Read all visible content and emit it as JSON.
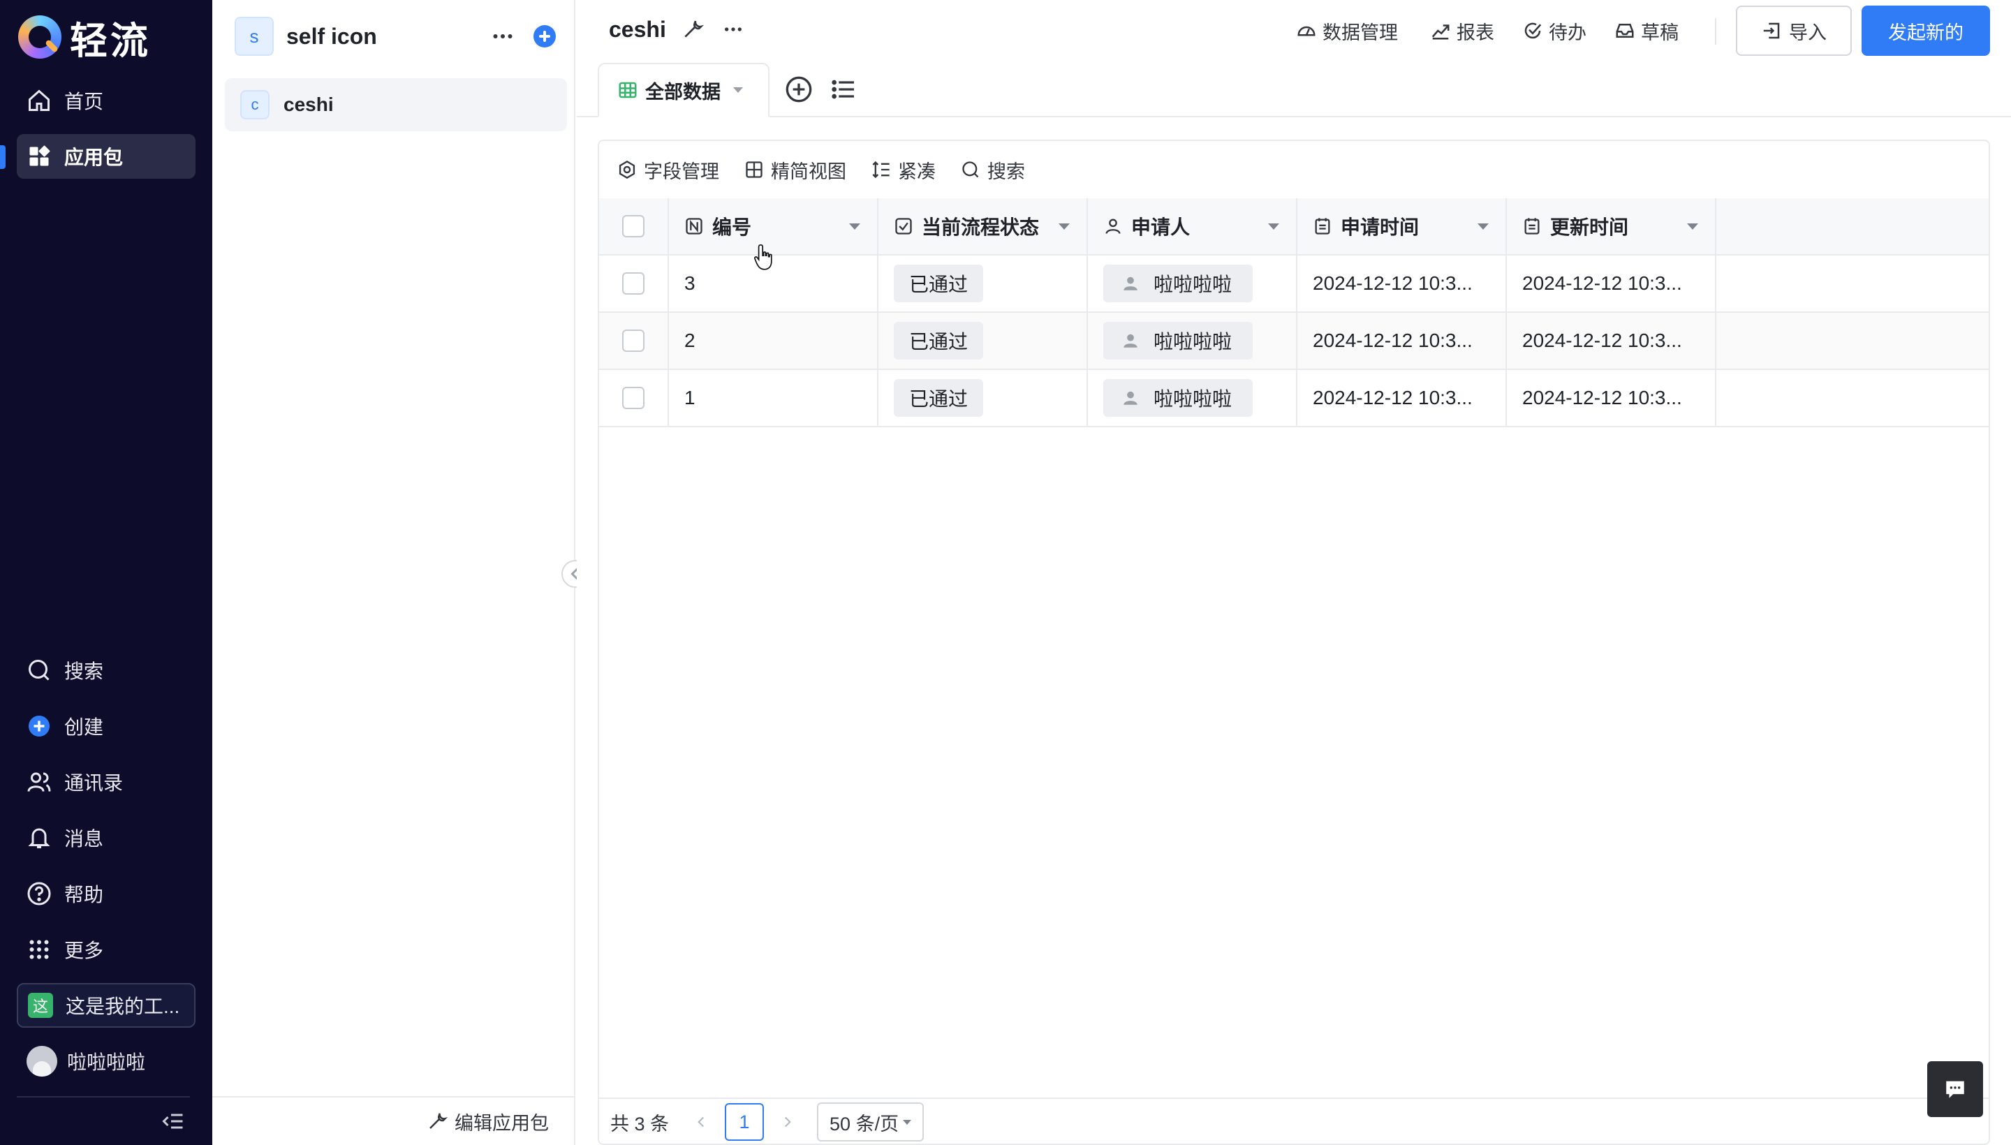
{
  "brand": {
    "name": "轻流"
  },
  "nav": {
    "items": [
      {
        "key": "home",
        "label": "首页",
        "icon": "home-icon"
      },
      {
        "key": "apps",
        "label": "应用包",
        "icon": "grid-apps-icon",
        "active": true
      },
      {
        "key": "search",
        "label": "搜索",
        "icon": "search-icon"
      },
      {
        "key": "create",
        "label": "创建",
        "icon": "plus-circle-icon"
      },
      {
        "key": "contacts",
        "label": "通讯录",
        "icon": "contacts-icon"
      },
      {
        "key": "messages",
        "label": "消息",
        "icon": "bell-icon"
      },
      {
        "key": "help",
        "label": "帮助",
        "icon": "help-icon"
      },
      {
        "key": "more",
        "label": "更多",
        "icon": "dots-grid-icon"
      }
    ],
    "workspace": {
      "badge": "这",
      "label": "这是我的工..."
    },
    "user": {
      "name": "啦啦啦啦"
    }
  },
  "package": {
    "badge": "s",
    "title": "self icon",
    "forms": [
      {
        "badge": "c",
        "name": "ceshi"
      }
    ],
    "footer_label": "编辑应用包"
  },
  "main": {
    "title": "ceshi",
    "top_links": [
      "数据管理",
      "报表",
      "待办",
      "草稿"
    ],
    "import_label": "导入",
    "new_label": "发起新的",
    "view_tab": "全部数据",
    "toolbar": [
      "字段管理",
      "精简视图",
      "紧凑",
      "搜索"
    ],
    "columns": [
      "编号",
      "当前流程状态",
      "申请人",
      "申请时间",
      "更新时间"
    ],
    "rows": [
      {
        "id": "3",
        "status": "已通过",
        "applicant": "啦啦啦啦",
        "applied": "2024-12-12 10:3...",
        "updated": "2024-12-12 10:3..."
      },
      {
        "id": "2",
        "status": "已通过",
        "applicant": "啦啦啦啦",
        "applied": "2024-12-12 10:3...",
        "updated": "2024-12-12 10:3..."
      },
      {
        "id": "1",
        "status": "已通过",
        "applicant": "啦啦啦啦",
        "applied": "2024-12-12 10:3...",
        "updated": "2024-12-12 10:3..."
      }
    ],
    "pager": {
      "total": "共 3 条",
      "page": "1",
      "size": "50 条/页"
    }
  },
  "colors": {
    "accent": "#2f7cf6",
    "nav_bg": "#0d0d2b",
    "workspace_badge": "#37b36c"
  }
}
